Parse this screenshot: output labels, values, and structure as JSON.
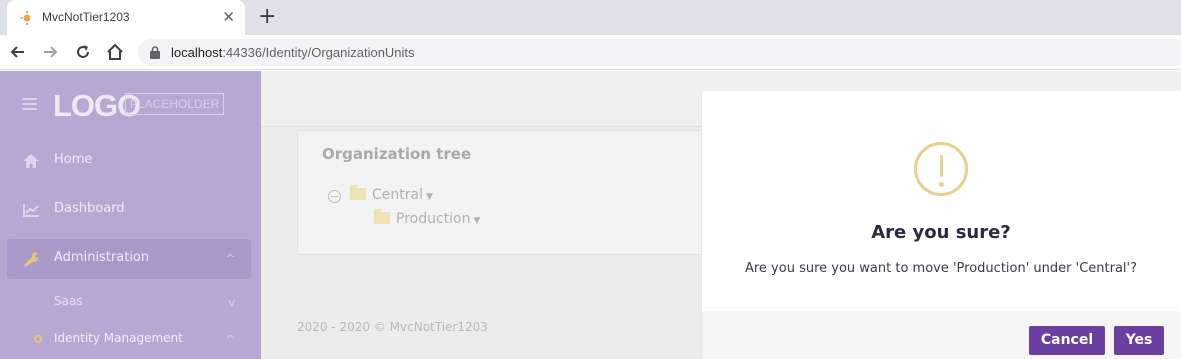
{
  "browser": {
    "tab_title": "MvcNotTier1203",
    "tab_close_glyph": "✕",
    "new_tab_glyph": "+",
    "url_host": "localhost",
    "url_rest": ":44336/Identity/OrganizationUnits",
    "icons": [
      "favicon",
      "back-icon",
      "forward-icon",
      "reload-icon",
      "home-icon",
      "lock-icon"
    ]
  },
  "sidebar": {
    "logo_text": "LOGO",
    "logo_sub": "PLACEHOLDER",
    "items": [
      {
        "label": "Home",
        "icon": "home-icon"
      },
      {
        "label": "Dashboard",
        "icon": "chart-icon"
      },
      {
        "label": "Administration",
        "icon": "wrench-icon",
        "chevron": "^"
      },
      {
        "label": "Saas",
        "chevron": "v"
      },
      {
        "label": "Identity Management",
        "chevron": "^"
      }
    ]
  },
  "main": {
    "card_title": "Organization tree",
    "tree": [
      {
        "label": "Central"
      },
      {
        "label": "Production"
      }
    ],
    "footer": "2020 - 2020 © MvcNotTier1203"
  },
  "modal": {
    "title": "Are you sure?",
    "text": "Are you sure you want to move 'Production' under 'Central'?",
    "cancel_label": "Cancel",
    "yes_label": "Yes",
    "icon": "warning-icon",
    "accent_color": "#6b3fa0",
    "warning_color": "#e8cf8f"
  }
}
